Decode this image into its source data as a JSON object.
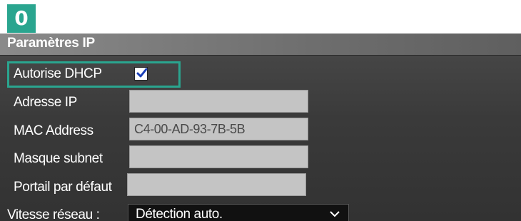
{
  "step_badge": "0",
  "panel": {
    "title": "Paramètres IP"
  },
  "fields": {
    "dhcp": {
      "label": "Autorise DHCP",
      "checked": true
    },
    "ip_address": {
      "label": "Adresse IP",
      "value": ""
    },
    "mac_address": {
      "label": "MAC Address",
      "value": "C4-00-AD-93-7B-5B"
    },
    "subnet_mask": {
      "label": "Masque subnet",
      "value": ""
    },
    "gateway": {
      "label": "Portail par défaut",
      "value": ""
    },
    "network_speed": {
      "label": "Vitesse réseau :",
      "value": "Détection auto."
    }
  },
  "colors": {
    "accent": "#2aa58f",
    "panel_bg": "#3a3a3a",
    "field_bg": "#c4c4c4",
    "select_bg": "#111111"
  },
  "icons": {
    "checkbox": "checkmark-icon",
    "dropdown": "chevron-down-icon"
  }
}
